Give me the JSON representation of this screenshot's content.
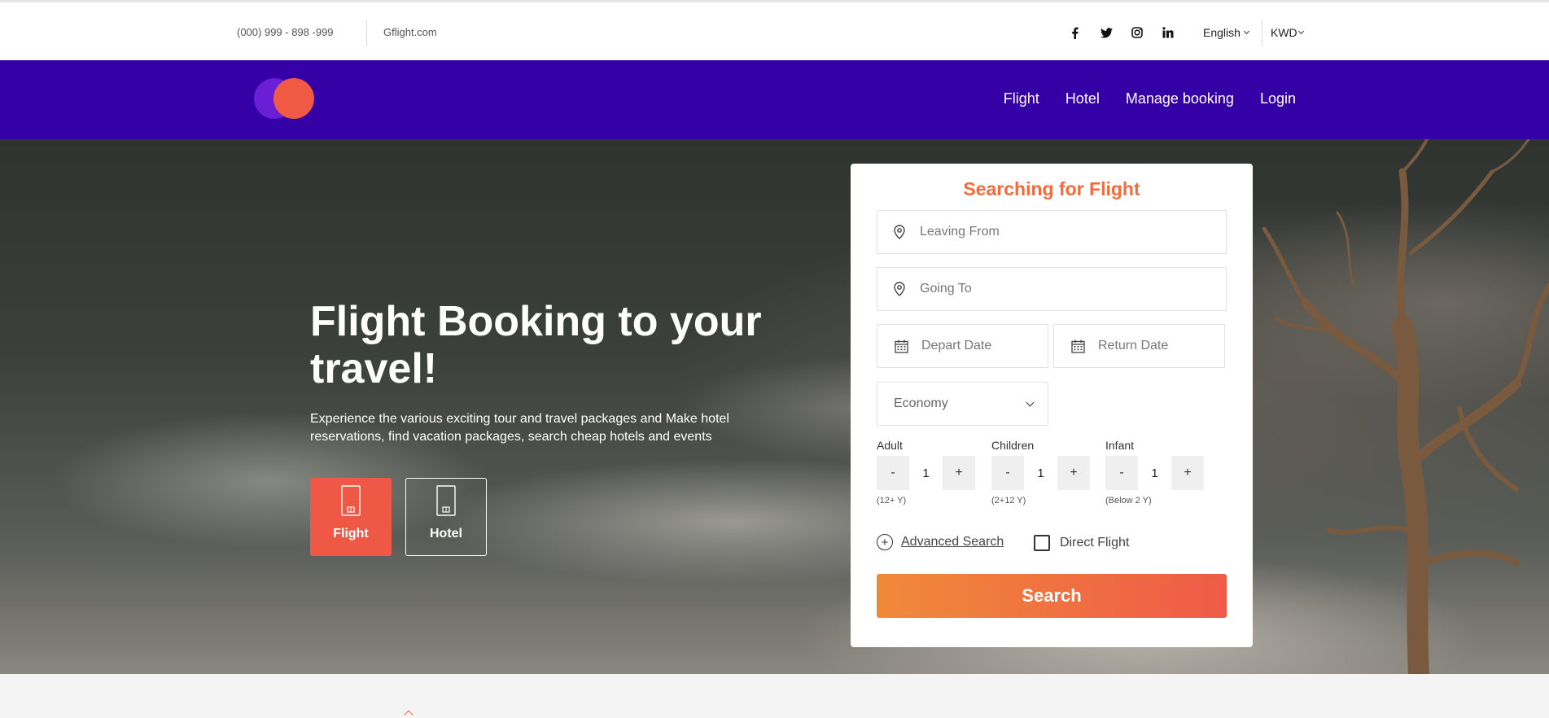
{
  "topbar": {
    "phone": "(000) 999 - 898 -999",
    "site": "Gflight.com",
    "social_icons": [
      "facebook-icon",
      "twitter-icon",
      "instagram-icon",
      "linkedin-icon"
    ],
    "language": "English",
    "currency": "KWD"
  },
  "nav": {
    "items": [
      "Flight",
      "Hotel",
      "Manage booking",
      "Login"
    ]
  },
  "hero": {
    "title": "Flight Booking to your travel!",
    "subtitle": "Experience the various exciting tour and travel packages and Make hotel reservations, find vacation packages, search cheap hotels and events",
    "services": [
      {
        "label": "Flight",
        "icon": "phone-icon",
        "active": true
      },
      {
        "label": "Hotel",
        "icon": "phone-icon",
        "active": false
      }
    ]
  },
  "search": {
    "title": "Searching for Flight",
    "leaving_placeholder": "Leaving From",
    "going_placeholder": "Going To",
    "depart_placeholder": "Depart Date",
    "return_placeholder": "Return Date",
    "cabin_class": "Economy",
    "passengers": [
      {
        "label": "Adult",
        "value": "1",
        "hint": "(12+ Y)"
      },
      {
        "label": "Children",
        "value": "1",
        "hint": "(2+12 Y)"
      },
      {
        "label": "Infant",
        "value": "1",
        "hint": "(Below 2 Y)"
      }
    ],
    "minus": "-",
    "plus": "+",
    "advanced_label": "Advanced Search",
    "direct_label": "Direct Flight",
    "button_label": "Search"
  },
  "colors": {
    "brand_purple": "#3500a6",
    "accent_orange": "#f06b3e",
    "accent_red": "#ef5844"
  }
}
